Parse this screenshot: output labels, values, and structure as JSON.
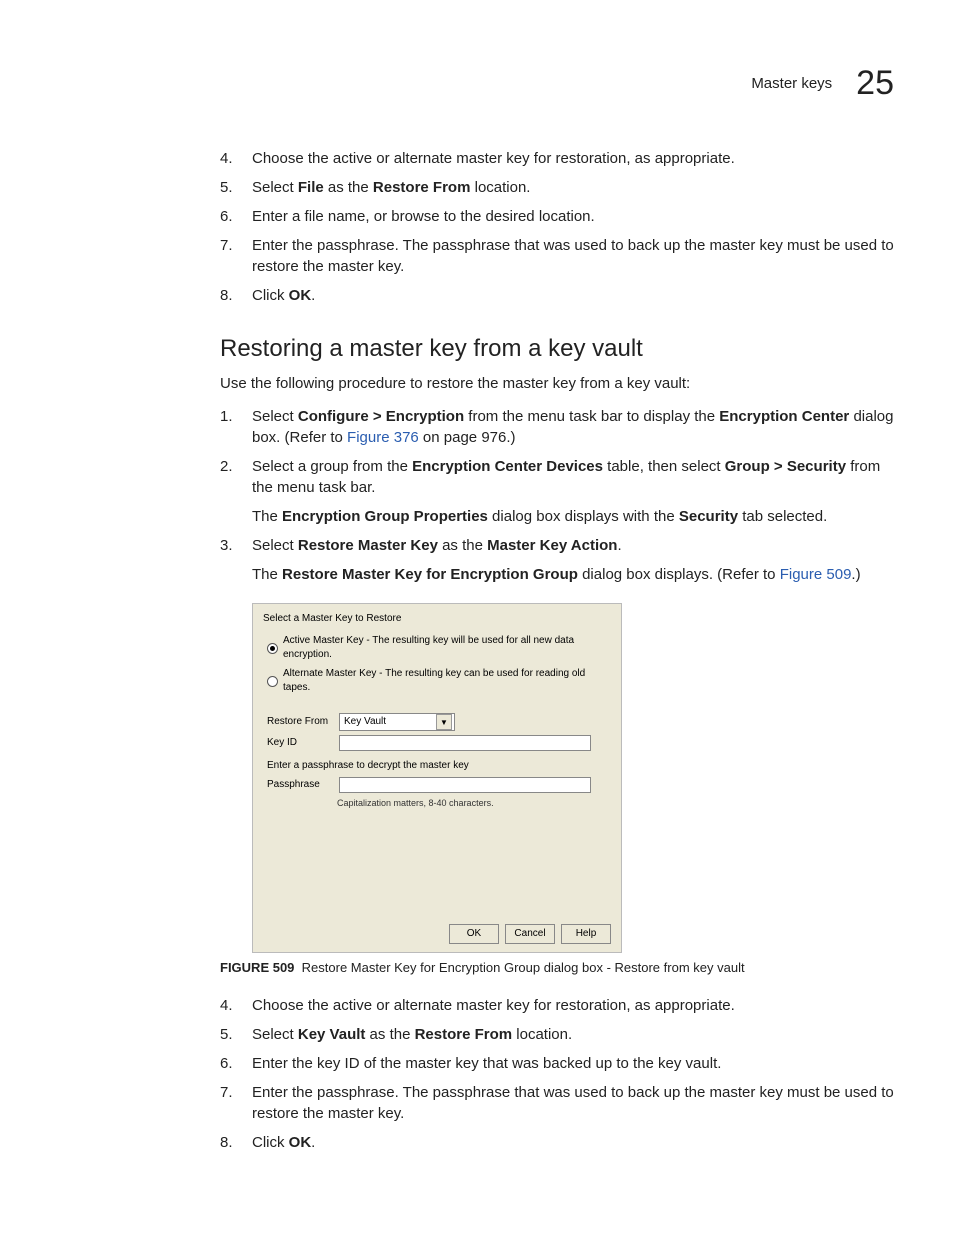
{
  "header": {
    "section": "Master keys",
    "chapter": "25"
  },
  "steps_top": [
    {
      "n": "4.",
      "text": "Choose the active or alternate master key for restoration, as appropriate."
    },
    {
      "n": "5.",
      "pre": "Select ",
      "b1": "File",
      "mid": " as the ",
      "b2": "Restore From",
      "post": " location."
    },
    {
      "n": "6.",
      "text": "Enter a file name, or browse to the desired location."
    },
    {
      "n": "7.",
      "text": "Enter the passphrase. The passphrase that was used to back up the master key must be used to restore the master key."
    },
    {
      "n": "8.",
      "pre": "Click ",
      "b1": "OK",
      "post": "."
    }
  ],
  "section_title": "Restoring a master key from a key vault",
  "intro": "Use the following procedure to restore the master key from a key vault:",
  "steps_mid": [
    {
      "n": "1.",
      "pre": "Select ",
      "b1": "Configure > Encryption",
      "mid": " from the menu task bar to display the ",
      "b2": "Encryption Center",
      "post": " dialog box. (Refer to ",
      "link": "Figure 376",
      "post2": " on page 976.)"
    },
    {
      "n": "2.",
      "pre": "Select a group from the ",
      "b1": "Encryption Center Devices",
      "mid": " table, then select ",
      "b2": "Group > Security",
      "post": " from the menu task bar.",
      "sub": {
        "pre": "The ",
        "b1": "Encryption Group Properties",
        "mid": " dialog box displays with the ",
        "b2": "Security",
        "post": " tab selected."
      }
    },
    {
      "n": "3.",
      "pre": "Select ",
      "b1": "Restore Master Key",
      "mid": " as the ",
      "b2": "Master Key Action",
      "post": ".",
      "sub": {
        "pre": "The ",
        "b1": "Restore Master Key for Encryption Group",
        "mid": " dialog box displays. (Refer to ",
        "link": "Figure 509",
        "post": ".)"
      }
    }
  ],
  "dialog": {
    "title": "Select a Master Key to Restore",
    "radio1": "Active Master Key - The resulting key will be used for all new data encryption.",
    "radio2": "Alternate Master Key - The resulting key can be used for reading old tapes.",
    "restore_from_label": "Restore From",
    "restore_from_value": "Key Vault",
    "keyid_label": "Key ID",
    "passphrase_prompt": "Enter a passphrase to decrypt the master key",
    "passphrase_label": "Passphrase",
    "hint": "Capitalization matters, 8-40 characters.",
    "ok": "OK",
    "cancel": "Cancel",
    "help": "Help"
  },
  "figure": {
    "num": "FIGURE 509",
    "caption": "Restore Master Key for Encryption Group dialog box - Restore from key vault"
  },
  "steps_bottom": [
    {
      "n": "4.",
      "text": "Choose the active or alternate master key for restoration, as appropriate."
    },
    {
      "n": "5.",
      "pre": "Select ",
      "b1": "Key Vault",
      "mid": " as the ",
      "b2": "Restore From",
      "post": " location."
    },
    {
      "n": "6.",
      "text": "Enter the key ID of the master key that was backed up to the key vault."
    },
    {
      "n": "7.",
      "text": "Enter the passphrase. The passphrase that was used to back up the master key must be used to restore the master key."
    },
    {
      "n": "8.",
      "pre": "Click ",
      "b1": "OK",
      "post": "."
    }
  ]
}
